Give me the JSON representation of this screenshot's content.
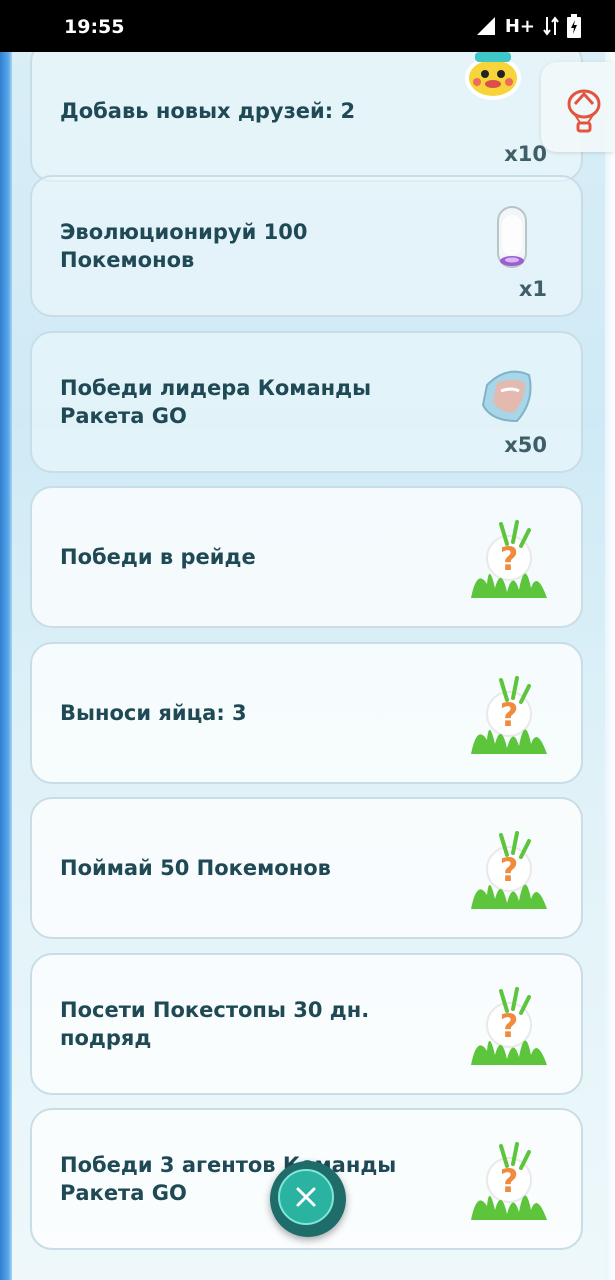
{
  "status_bar": {
    "time": "19:55",
    "network": "H+"
  },
  "tasks": [
    {
      "title": "Добавь новых друзей: 2",
      "reward_icon": "poke-ball-icon",
      "reward_count": "x10"
    },
    {
      "title": "Эволюционируй 100 Покемонов",
      "reward_icon": "incubator-icon",
      "reward_count": "x1"
    },
    {
      "title": "Победи лидера Команды Ракета GO",
      "reward_icon": "stardust-icon",
      "reward_count": "x50"
    },
    {
      "title": "Победи в рейде",
      "reward_icon": "mystery-encounter-icon",
      "reward_count": ""
    },
    {
      "title": "Выноси яйца: 3",
      "reward_icon": "mystery-encounter-icon",
      "reward_count": ""
    },
    {
      "title": "Поймай 50 Покемонов",
      "reward_icon": "mystery-encounter-icon",
      "reward_count": ""
    },
    {
      "title": "Посети Покестопы 30 дн. подряд",
      "reward_icon": "mystery-encounter-icon",
      "reward_count": ""
    },
    {
      "title": "Победи 3 агентов Команды Ракета GO",
      "reward_icon": "mystery-encounter-icon",
      "reward_count": ""
    }
  ],
  "colors": {
    "frame_blue": "#2f7fd0",
    "title_text": "#1f4a55",
    "close_button": "#2bb3a2",
    "question_mark": "#f08a3c",
    "grass": "#5cc53c"
  }
}
